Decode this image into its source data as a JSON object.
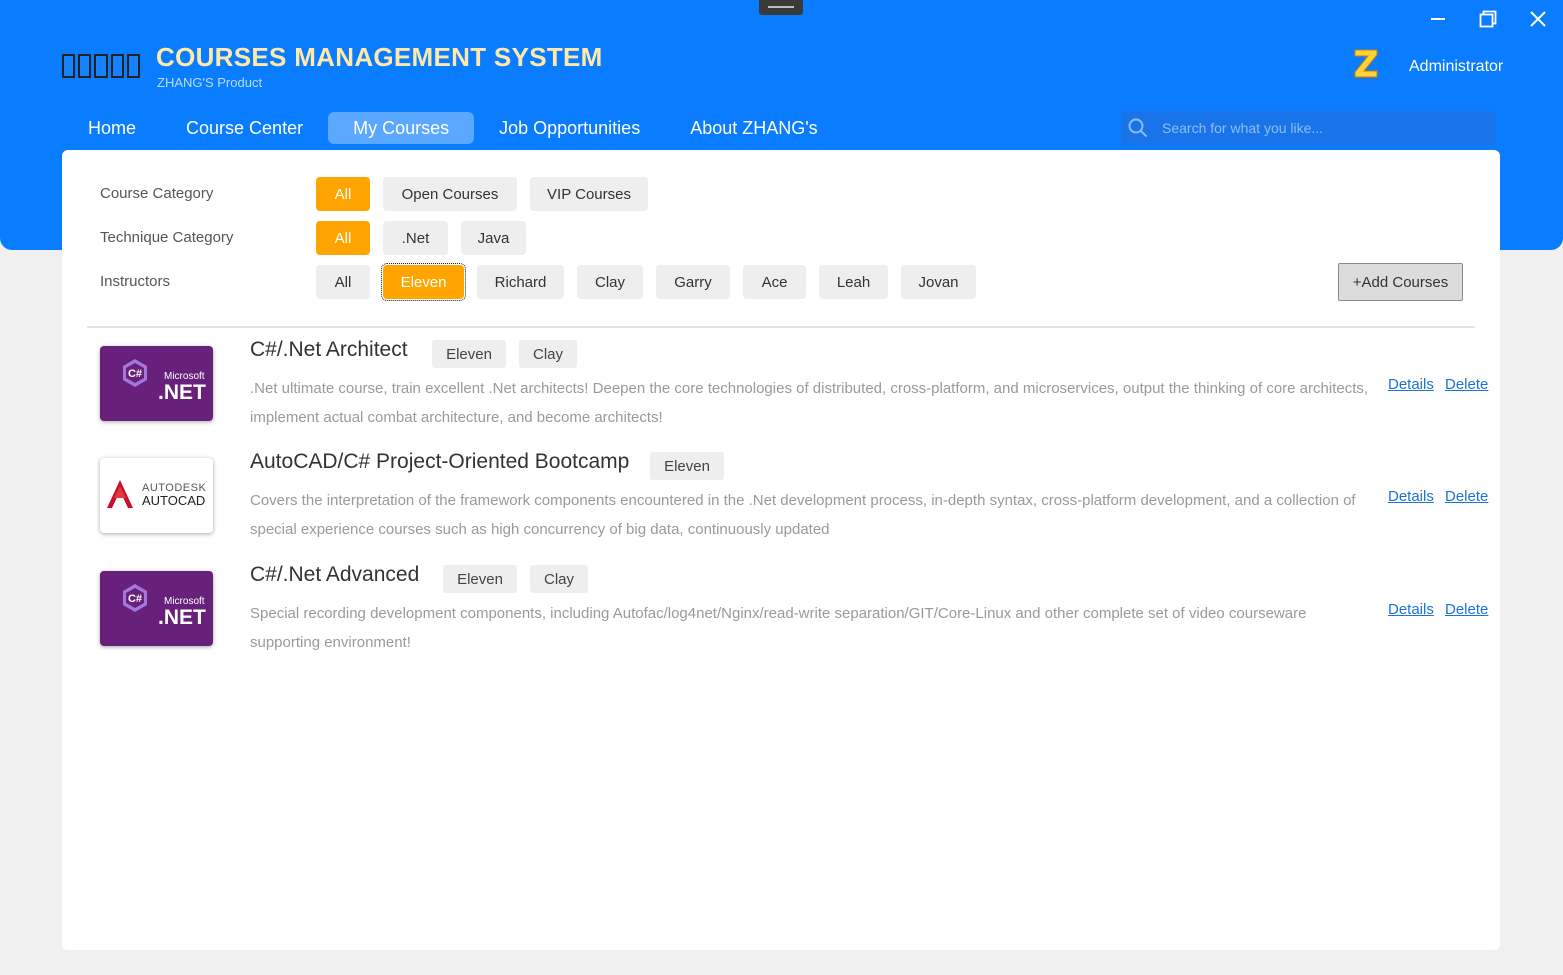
{
  "app": {
    "title": "COURSES MANAGEMENT SYSTEM",
    "subtitle": "ZHANG'S Product",
    "user": "Administrator",
    "accent_color": "#0a7cff",
    "highlight_color": "#ffa400"
  },
  "nav": {
    "items": [
      {
        "label": "Home",
        "active": false
      },
      {
        "label": "Course Center",
        "active": false
      },
      {
        "label": "My Courses",
        "active": true
      },
      {
        "label": "Job Opportunities",
        "active": false
      },
      {
        "label": "About ZHANG's",
        "active": false
      }
    ]
  },
  "search": {
    "placeholder": "Search for what you like...",
    "value": ""
  },
  "filters": {
    "course_category": {
      "label": "Course Category",
      "options": [
        "All",
        "Open Courses",
        "VIP Courses"
      ],
      "selected": "All"
    },
    "technique_category": {
      "label": "Technique Category",
      "options": [
        "All",
        ".Net",
        "Java"
      ],
      "selected": "All"
    },
    "instructors": {
      "label": "Instructors",
      "options": [
        "All",
        "Eleven",
        "Richard",
        "Clay",
        "Garry",
        "Ace",
        "Leah",
        "Jovan"
      ],
      "selected": "Eleven"
    }
  },
  "add_button": {
    "label": "+Add Courses"
  },
  "courses": [
    {
      "title": "C#/.Net Architect",
      "thumbnail": {
        "type": "dotnet-logo",
        "brand": "Microsoft",
        "name": ".NET"
      },
      "instructors": [
        "Eleven",
        "Clay"
      ],
      "description": ".Net ultimate course, train excellent .Net architects! Deepen the core technologies of distributed, cross-platform, and microservices, output the thinking of core architects, implement actual combat architecture, and become architects!",
      "details_label": "Details",
      "delete_label": "Delete"
    },
    {
      "title": "AutoCAD/C# Project-Oriented Bootcamp",
      "thumbnail": {
        "type": "autocad-logo",
        "brand": "AUTODESK",
        "name": "AUTOCAD"
      },
      "instructors": [
        "Eleven"
      ],
      "description": "Covers the interpretation of the framework components encountered in the .Net development process, in-depth syntax, cross-platform development, and a collection of special experience courses such as high concurrency of big data, continuously updated",
      "details_label": "Details",
      "delete_label": "Delete"
    },
    {
      "title": "C#/.Net Advanced",
      "thumbnail": {
        "type": "dotnet-logo",
        "brand": "Microsoft",
        "name": ".NET"
      },
      "instructors": [
        "Eleven",
        "Clay"
      ],
      "description": "Special recording development components, including Autofac/log4net/Nginx/read-write separation/GIT/Core-Linux and other complete set of video courseware supporting environment!",
      "details_label": "Details",
      "delete_label": "Delete"
    }
  ]
}
